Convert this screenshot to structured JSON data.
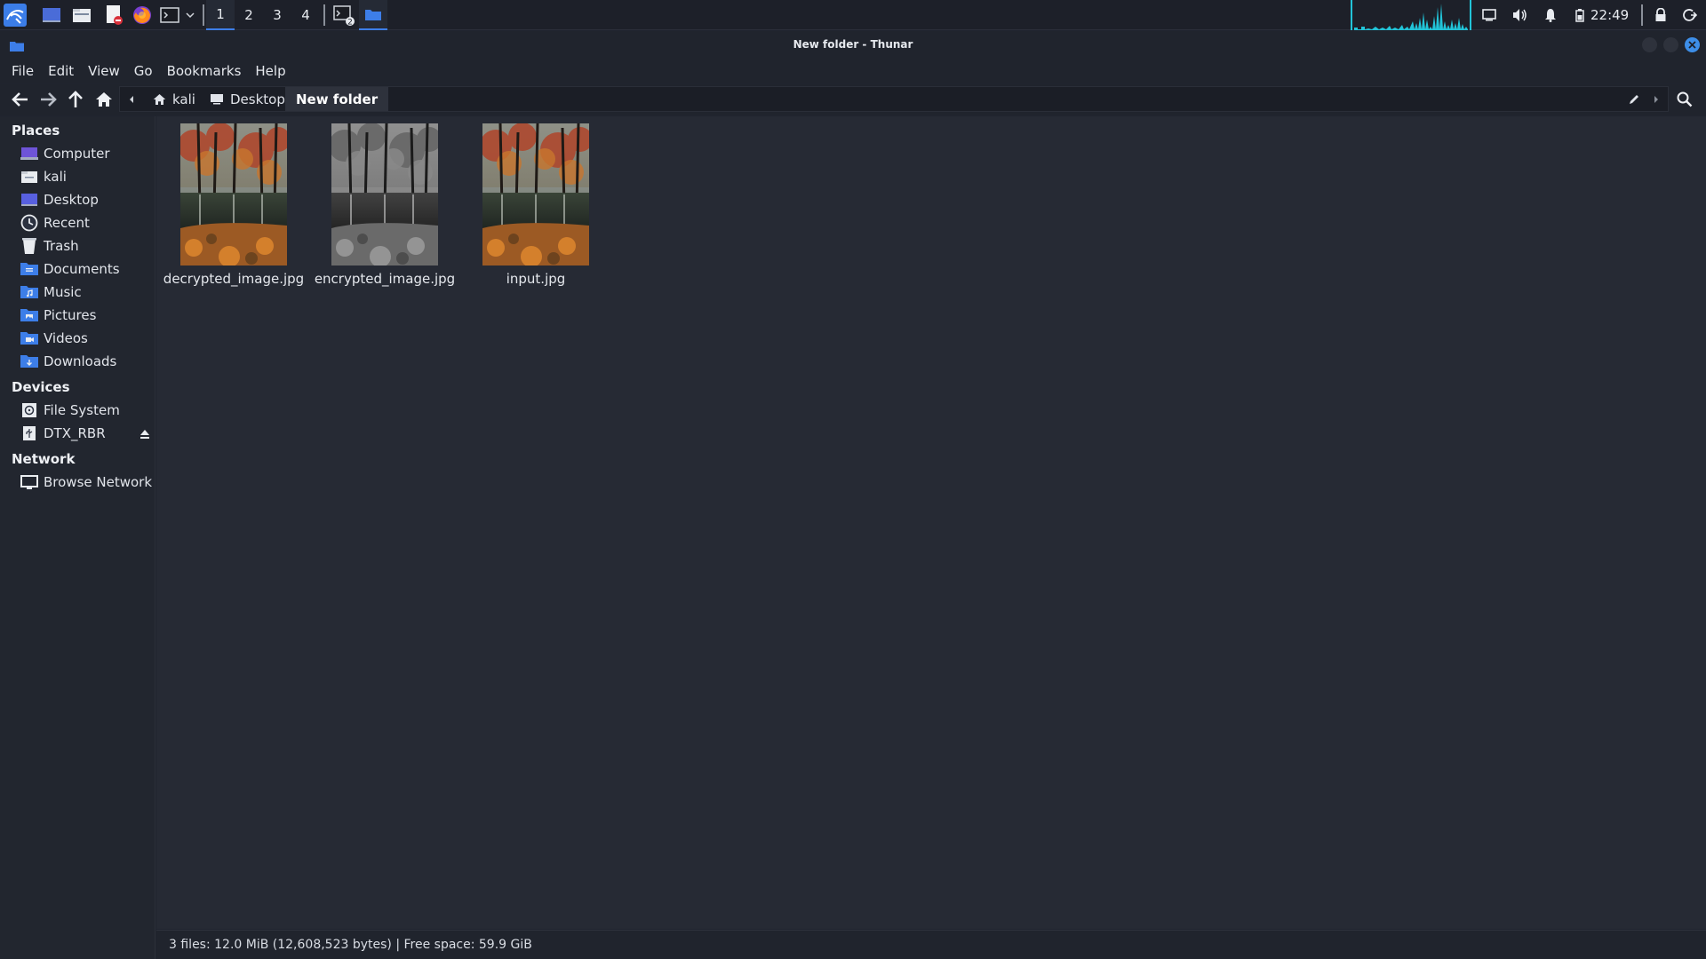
{
  "panel": {
    "workspaces": [
      "1",
      "2",
      "3",
      "4"
    ],
    "active_workspace": "1",
    "terminal_badge": "2",
    "clock": "22:49",
    "graph_color": "#22c4d8",
    "launchers": [
      "kali-menu-icon",
      "desktop-icon",
      "file-manager-icon",
      "text-editor-icon",
      "firefox-icon",
      "terminal-icon"
    ]
  },
  "window": {
    "title": "New folder - Thunar"
  },
  "menubar": {
    "items": [
      "File",
      "Edit",
      "View",
      "Go",
      "Bookmarks",
      "Help"
    ]
  },
  "pathbar": {
    "crumbs": [
      "kali",
      "Desktop"
    ],
    "current": "New folder"
  },
  "sidebar": {
    "places_title": "Places",
    "places": [
      "Computer",
      "kali",
      "Desktop",
      "Recent",
      "Trash",
      "Documents",
      "Music",
      "Pictures",
      "Videos",
      "Downloads"
    ],
    "devices_title": "Devices",
    "devices": [
      "File System",
      "DTX_RBR"
    ],
    "network_title": "Network",
    "network": [
      "Browse Network"
    ]
  },
  "files": [
    {
      "name": "decrypted_image.jpg",
      "style": "color"
    },
    {
      "name": "encrypted_image.jpg",
      "style": "grayscale"
    },
    {
      "name": "input.jpg",
      "style": "color"
    }
  ],
  "status": {
    "text": "3 files: 12.0 MiB (12,608,523 bytes)  |  Free space: 59.9 GiB"
  },
  "colors": {
    "accent": "#3d7ee8",
    "close_button": "#3d8ee8",
    "background": "#262a34"
  }
}
